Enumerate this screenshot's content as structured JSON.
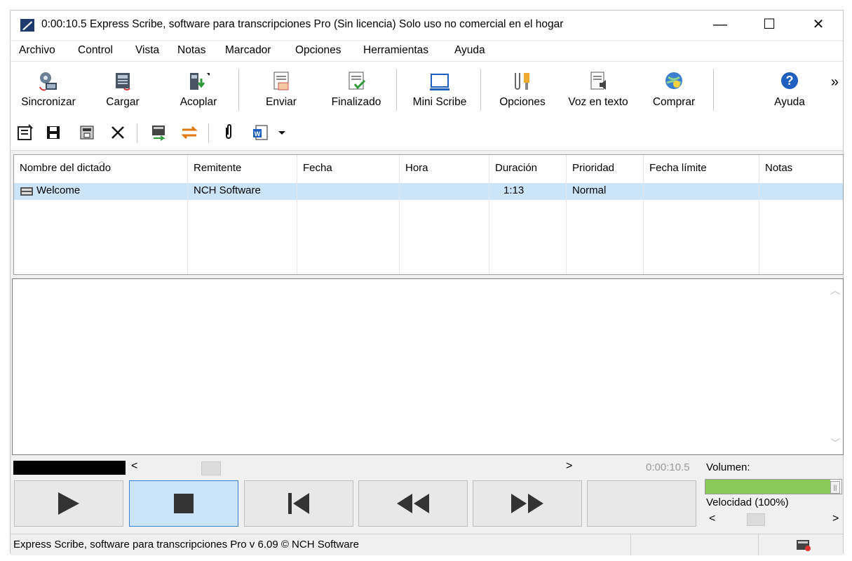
{
  "window": {
    "title": "0:00:10.5 Express Scribe, software para transcripciones Pro (Sin licencia) Solo uso no comercial en el hogar",
    "controls": {
      "minimize": "—",
      "maximize": "☐",
      "close": "✕"
    }
  },
  "menu": [
    "Archivo",
    "Control",
    "Vista",
    "Notas",
    "Marcador",
    "Opciones",
    "Herramientas",
    "Ayuda"
  ],
  "toolbar": {
    "sync": "Sincronizar",
    "load": "Cargar",
    "dock": "Acoplar",
    "send": "Enviar",
    "done": "Finalizado",
    "mini": "Mini Scribe",
    "options": "Opciones",
    "tts": "Voz en texto",
    "buy": "Comprar",
    "help": "Ayuda",
    "more": "»"
  },
  "list": {
    "columns": [
      "Nombre del dictado",
      "Remitente",
      "Fecha",
      "Hora",
      "Duración",
      "Prioridad",
      "Fecha límite",
      "Notas"
    ],
    "rows": [
      {
        "name": "Welcome",
        "sender": "NCH Software",
        "date": "",
        "time": "",
        "duration": "1:13",
        "priority": "Normal",
        "deadline": "",
        "notes": ""
      }
    ]
  },
  "player": {
    "time": "0:00:10.5",
    "volume_label": "Volumen:",
    "volume_level": 0.92,
    "speed_label": "Velocidad (100%)",
    "scroll_left": "<",
    "scroll_right": ">"
  },
  "status": {
    "text": "Express Scribe, software para transcripciones Pro v 6.09 © NCH Software"
  }
}
